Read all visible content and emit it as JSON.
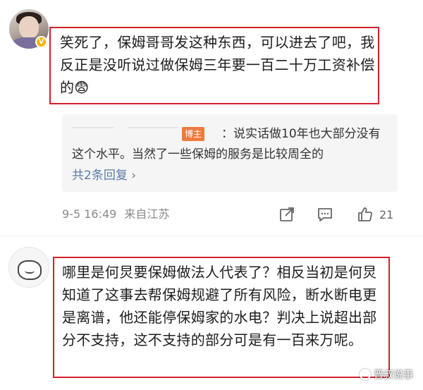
{
  "comment1": {
    "text": "笑死了，保姆哥哥发这种东西，可以进去了吧，我反正是没听说过做保姆三年要一百二十万工资补偿的😨"
  },
  "reply": {
    "author_badge": "博主",
    "text": "：说实话做10年也大部分没有这个水平。当然了一些保姆的服务是比较周全的",
    "more": "共2条回复 ›"
  },
  "meta": {
    "time": "9-5 16:49",
    "location": "来自江苏",
    "like_count": "21"
  },
  "comment2": {
    "text": "哪里是何炅要保姆做法人代表了？相反当初是何炅知道了这事去帮保姆规避了所有风险，断水断电更是离谱，他还能停保姆家的水电？判决上说超出部分不支持，这不支持的部分可是有一百来万呢。"
  },
  "watermark": {
    "text": "晋叔说事"
  },
  "colors": {
    "highlight_border": "#d2202c",
    "author_badge": "#f07a3c",
    "link": "#5b7ba8"
  }
}
